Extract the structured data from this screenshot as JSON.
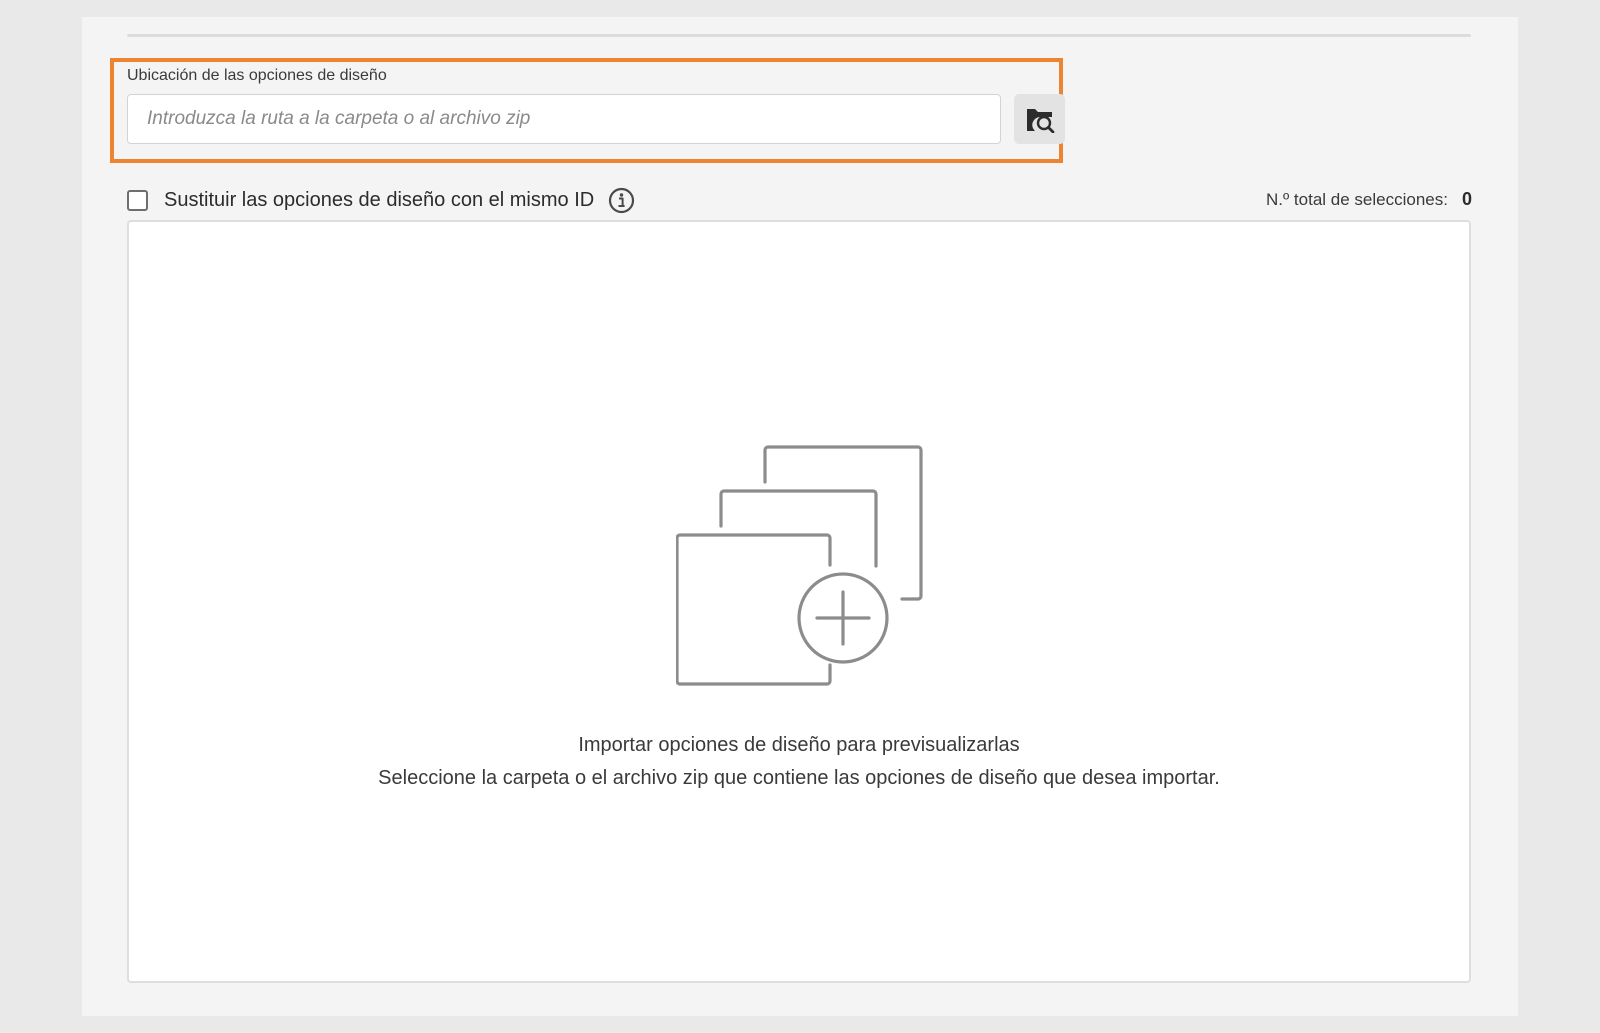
{
  "location": {
    "label": "Ubicación de las opciones de diseño",
    "value": "",
    "placeholder": "Introduzca la ruta a la carpeta o al archivo zip",
    "browse_icon": "folder-search-icon"
  },
  "replace_option": {
    "label": "Sustituir las opciones de diseño con el mismo ID",
    "checked": false,
    "info_icon": "info-icon"
  },
  "selection_summary": {
    "label": "N.º total de selecciones:",
    "count": "0"
  },
  "empty_state": {
    "icon": "import-layouts-icon",
    "title": "Importar opciones de diseño para previsualizarlas",
    "description": "Seleccione la carpeta o el archivo zip que contiene las opciones de diseño que desea importar."
  },
  "colors": {
    "highlight": "#ef8430",
    "panel_background": "#f4f4f4",
    "page_background": "#e9e9e9",
    "icon_gray": "#8c8c8c"
  }
}
